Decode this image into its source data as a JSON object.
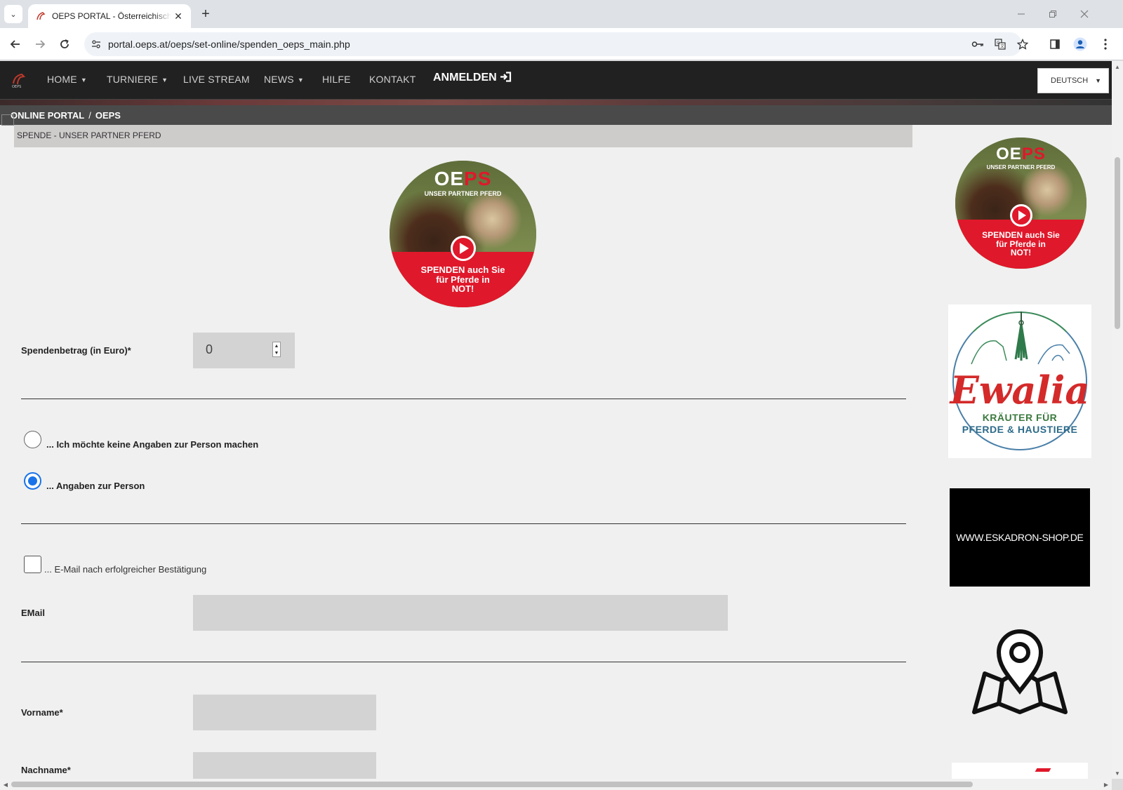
{
  "browser": {
    "tab_title": "OEPS PORTAL - Österreichische",
    "url": "portal.oeps.at/oeps/set-online/spenden_oeps_main.php",
    "new_tab_symbol": "+",
    "close_tab_symbol": "✕",
    "icons": [
      "tab-menu-icon",
      "favicon-horse-icon",
      "back-icon",
      "forward-icon",
      "reload-icon",
      "site-settings-icon",
      "password-key-icon",
      "translate-icon",
      "bookmark-star-icon",
      "side-panel-icon",
      "profile-icon",
      "menu-dots-icon",
      "minimize-icon",
      "restore-icon",
      "close-window-icon"
    ]
  },
  "nav": {
    "items": [
      {
        "label": "HOME",
        "has_caret": true
      },
      {
        "label": "TURNIERE",
        "has_caret": true
      },
      {
        "label": "LIVE STREAM",
        "has_caret": false
      },
      {
        "label": "NEWS",
        "has_caret": true
      },
      {
        "label": "HILFE",
        "has_caret": false
      },
      {
        "label": "KONTAKT",
        "has_caret": false
      }
    ],
    "login_label": "ANMELDEN",
    "language": "DEUTSCH"
  },
  "breadcrumb": {
    "root": "ONLINE PORTAL",
    "separator": "/",
    "current": "OEPS"
  },
  "section_title": "SPENDE - UNSER PARTNER PFERD",
  "banner": {
    "brand_oe": "OE",
    "brand_ps": "PS",
    "subtitle": "UNSER PARTNER PFERD",
    "line1": "SPENDEN auch Sie",
    "line2": "für Pferde in",
    "line3": "NOT!"
  },
  "form": {
    "amount_label": "Spendenbetrag (in Euro)*",
    "amount_value": "0",
    "option_anonymous": "... Ich möchte keine Angaben zur Person machen",
    "option_person": "... Angaben zur Person",
    "selected_option": "person",
    "email_confirm_label": "... E-Mail nach erfolgreicher Bestätigung",
    "email_confirm_checked": false,
    "email_label": "EMail",
    "firstname_label": "Vorname*",
    "lastname_label": "Nachname*"
  },
  "sidebar": {
    "evalia_word": "Ewalia",
    "evalia_line1": "KRÄUTER FÜR",
    "evalia_line2": "PFERDE & HAUSTIERE",
    "eskadron_text": "WWW.ESKADRON-SHOP.DE",
    "map_icon": "map-pin-icon"
  },
  "colors": {
    "navbar": "#212121",
    "accent_red": "#e0182b",
    "radio_blue": "#1a73e8",
    "page_bg": "#eff0ef",
    "input_bg": "#d3d3d3"
  }
}
